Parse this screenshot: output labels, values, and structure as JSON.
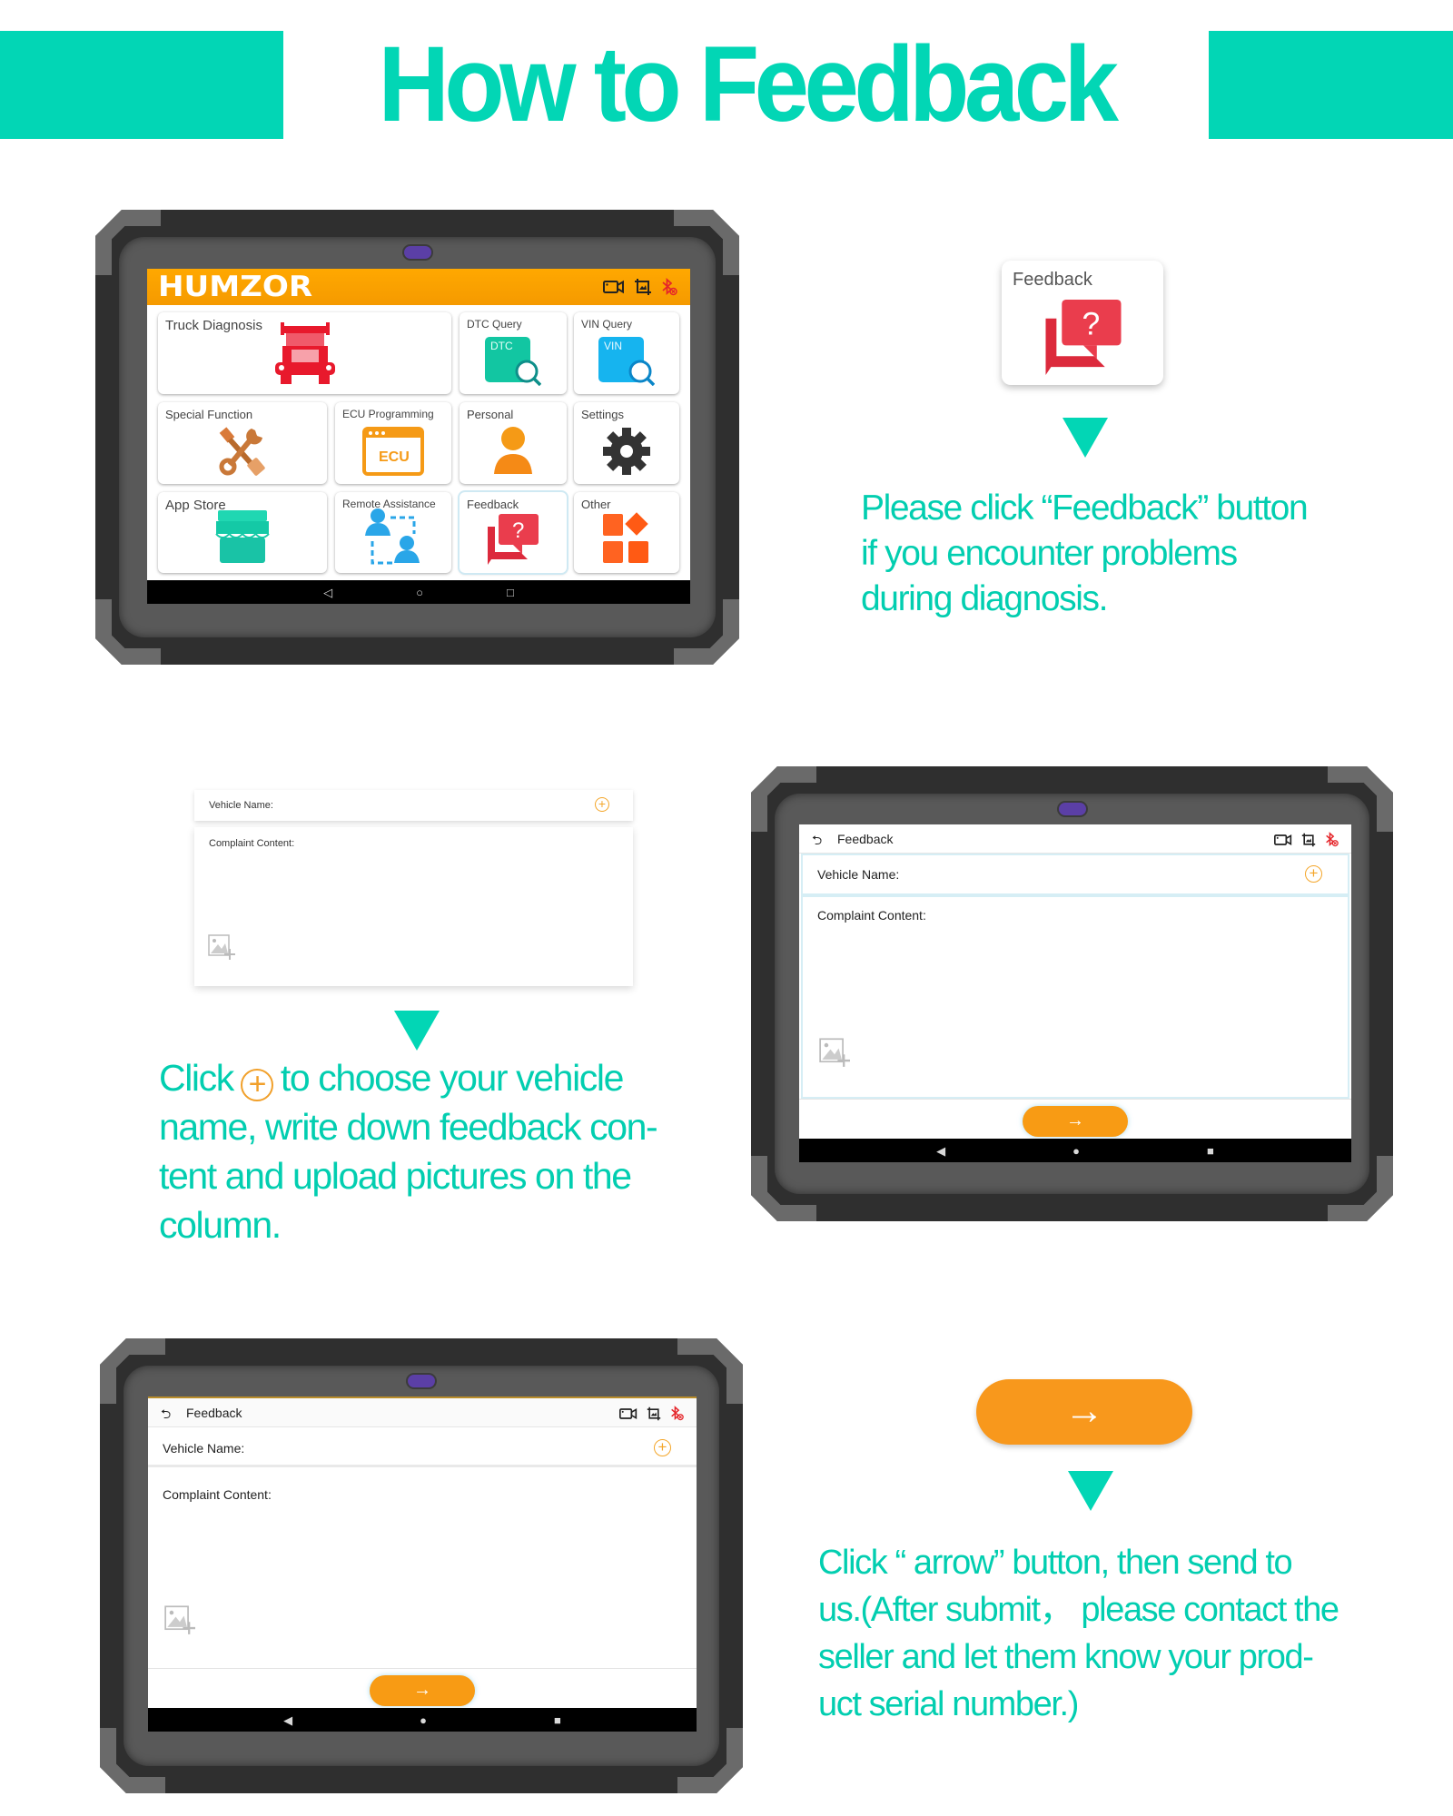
{
  "page": {
    "title": "How to Feedback",
    "accent_color": "#02d6b5",
    "button_color": "#f8981c"
  },
  "home_screen": {
    "brand": "HUMZOR",
    "status_icons": [
      "video-camera-icon",
      "screenshot-icon",
      "bluetooth-disconnected-icon"
    ],
    "tiles": [
      {
        "label": "Truck Diagnosis",
        "icon": "truck-icon"
      },
      {
        "label": "DTC Query",
        "icon": "dtc-query-icon",
        "badge": "DTC"
      },
      {
        "label": "VIN Query",
        "icon": "vin-query-icon",
        "badge": "VIN"
      },
      {
        "label": "Special Function",
        "icon": "tools-icon"
      },
      {
        "label": "ECU Programming",
        "icon": "ecu-icon",
        "badge": "ECU"
      },
      {
        "label": "Personal",
        "icon": "person-icon"
      },
      {
        "label": "Settings",
        "icon": "gear-icon"
      },
      {
        "label": "App Store",
        "icon": "store-icon"
      },
      {
        "label": "Remote Assistance",
        "icon": "remote-assistance-icon"
      },
      {
        "label": "Feedback",
        "icon": "feedback-icon"
      },
      {
        "label": "Other",
        "icon": "other-apps-icon"
      }
    ],
    "nav": {
      "back": "◁",
      "home": "○",
      "recent": "□"
    }
  },
  "step1": {
    "tile_label": "Feedback",
    "lines": [
      "Please click “Feedback” button",
      "if  you encounter problems",
      "during diagnosis."
    ]
  },
  "form": {
    "header_title": "Feedback",
    "back_symbol": "⮌",
    "vehicle_label": "Vehicle Name:",
    "complaint_label": "Complaint Content:",
    "plus_symbol": "+",
    "submit_symbol": "→",
    "nav": {
      "back": "◀",
      "home": "●",
      "recent": "■"
    }
  },
  "step2": {
    "line1_before": "Click",
    "line1_after": "to  choose your vehicle",
    "lines": [
      "name, write down feedback con-",
      "tent and upload pictures on the",
      "column."
    ]
  },
  "step3": {
    "button_symbol": "→",
    "lines": [
      "Click  “ arrow”  button, then send to",
      "us.(After  submit， please contact the",
      "seller and  let them know your prod-",
      "uct serial number.)"
    ]
  }
}
